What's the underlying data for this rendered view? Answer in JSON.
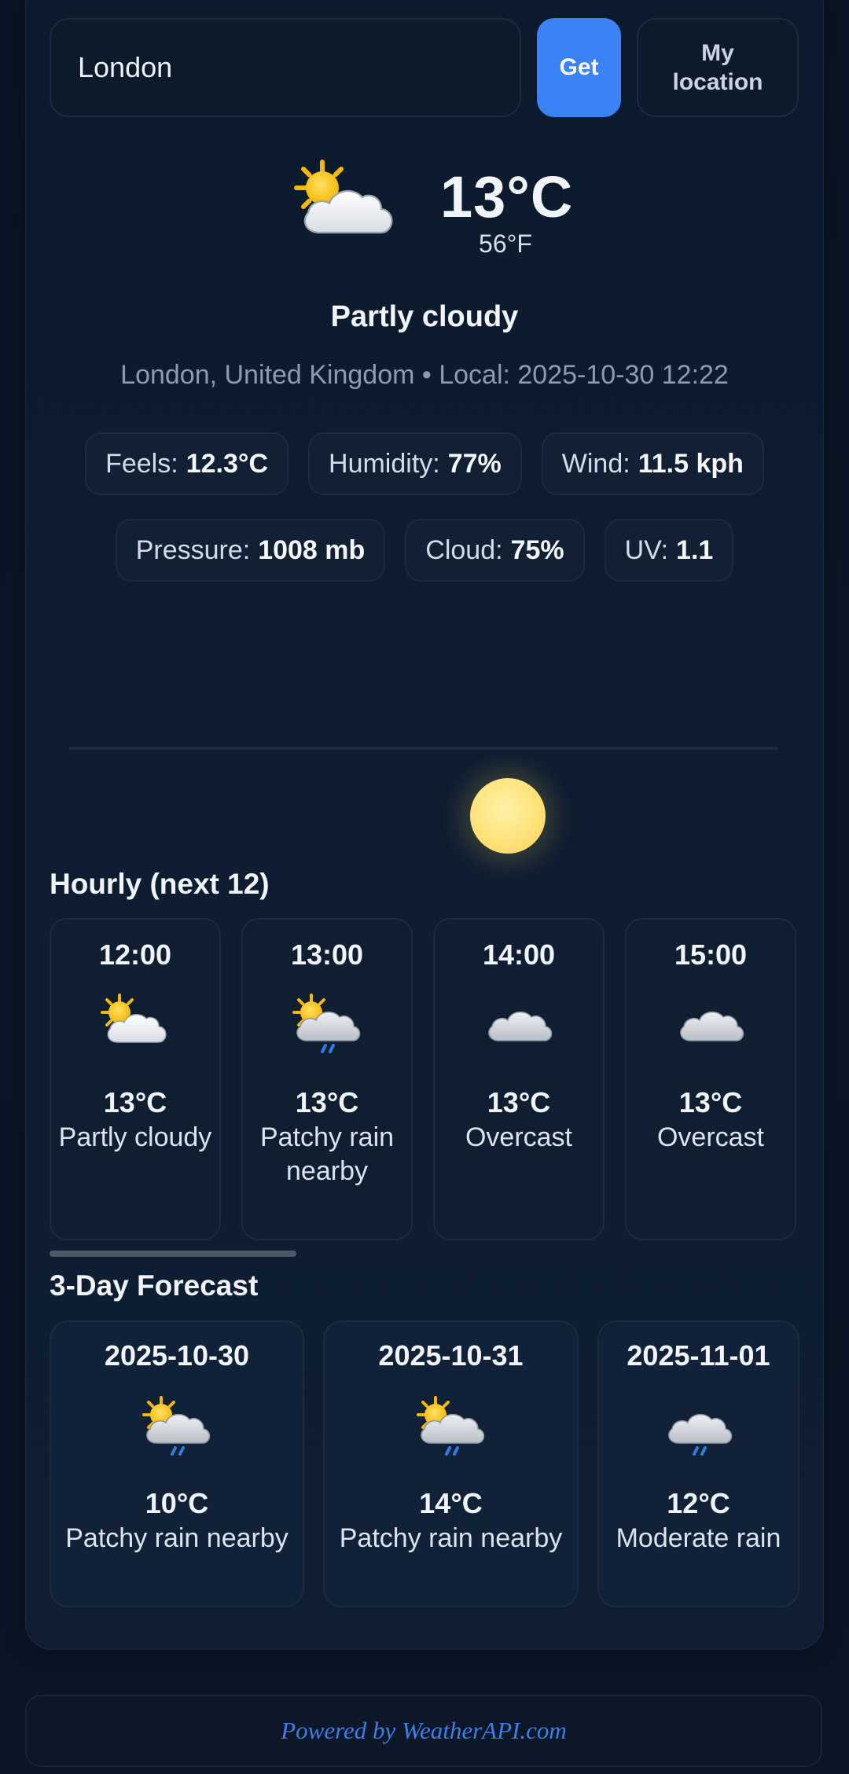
{
  "search": {
    "value": "London",
    "get_label": "Get",
    "my_location_label": "My location"
  },
  "current": {
    "icon": "partly-cloudy-icon",
    "temp_c": "13°C",
    "temp_f": "56°F",
    "condition": "Partly cloudy",
    "location_line": "London, United Kingdom • Local: 2025-10-30 12:22",
    "stats_row1": [
      {
        "label": "Feels:",
        "value": "12.3°C"
      },
      {
        "label": "Humidity:",
        "value": "77%"
      },
      {
        "label": "Wind:",
        "value": "11.5 kph"
      }
    ],
    "stats_row2": [
      {
        "label": "Pressure:",
        "value": "1008 mb"
      },
      {
        "label": "Cloud:",
        "value": "75%"
      },
      {
        "label": "UV:",
        "value": "1.1"
      }
    ]
  },
  "hourly": {
    "title": "Hourly (next 12)",
    "items": [
      {
        "time": "12:00",
        "icon": "partly-cloudy-icon",
        "temp": "13°C",
        "desc": "Partly cloudy"
      },
      {
        "time": "13:00",
        "icon": "patchy-rain-icon",
        "temp": "13°C",
        "desc": "Patchy rain nearby"
      },
      {
        "time": "14:00",
        "icon": "overcast-icon",
        "temp": "13°C",
        "desc": "Overcast"
      },
      {
        "time": "15:00",
        "icon": "overcast-icon",
        "temp": "13°C",
        "desc": "Overcast"
      }
    ]
  },
  "forecast": {
    "title": "3-Day Forecast",
    "items": [
      {
        "date": "2025-10-30",
        "icon": "patchy-rain-icon",
        "temp": "10°C",
        "desc": "Patchy rain nearby"
      },
      {
        "date": "2025-10-31",
        "icon": "patchy-rain-icon",
        "temp": "14°C",
        "desc": "Patchy rain nearby"
      },
      {
        "date": "2025-11-01",
        "icon": "moderate-rain-icon",
        "temp": "12°C",
        "desc": "Moderate rain"
      }
    ]
  },
  "footer": {
    "text": "Powered by WeatherAPI.com"
  },
  "colors": {
    "accent": "#3b82f6",
    "background": "#0b1627",
    "link": "#3f7ee8"
  }
}
